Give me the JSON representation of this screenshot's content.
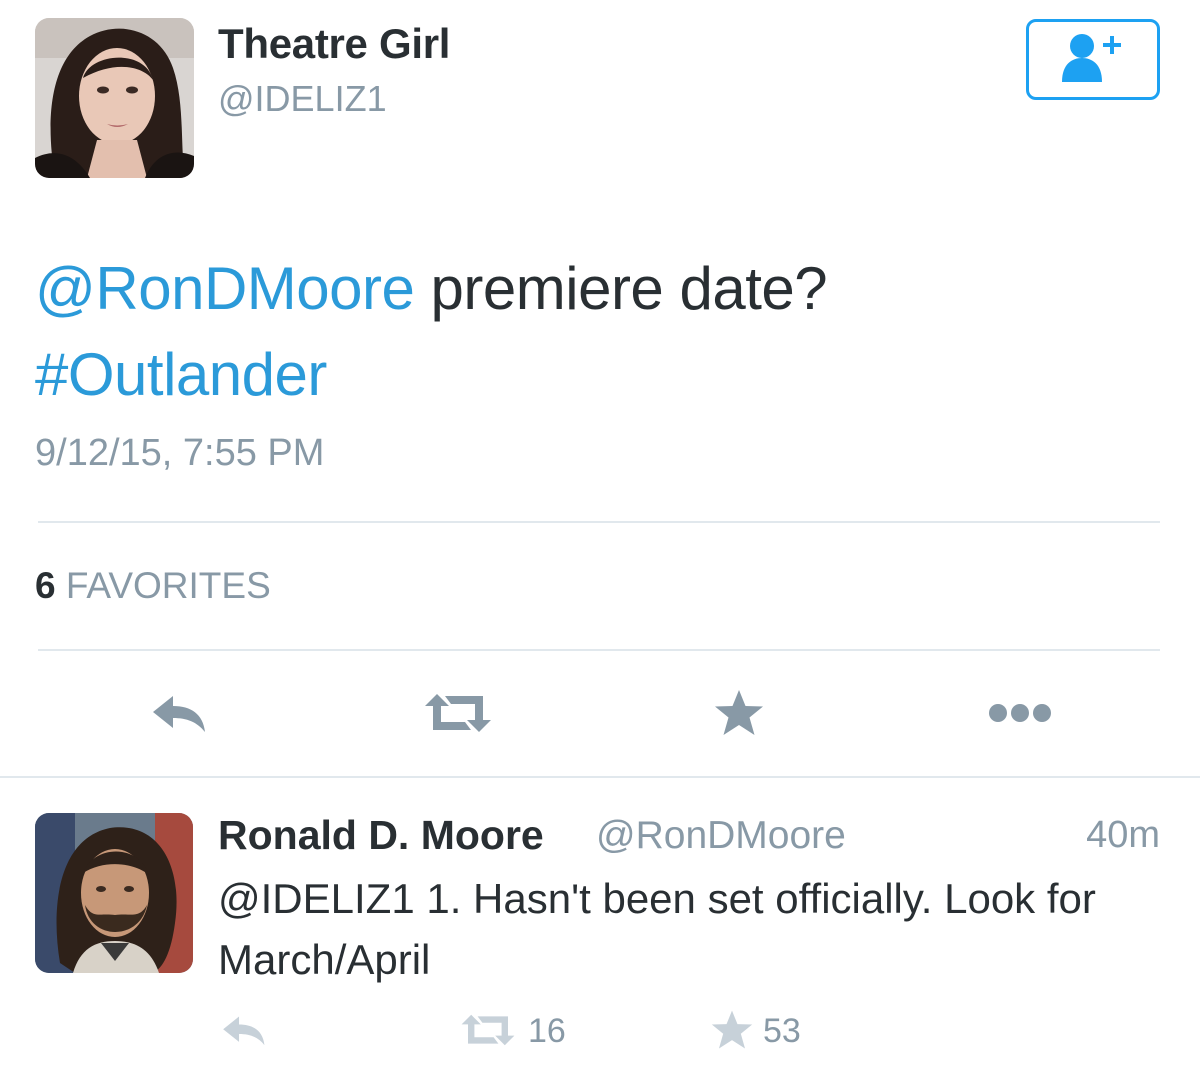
{
  "tweet": {
    "display_name": "Theatre Girl",
    "handle": "@IDELIZ1",
    "follow_icon": "add-user-icon",
    "mention": "@RonDMoore",
    "text": " premiere date?",
    "hashtag": "#Outlander",
    "timestamp": "9/12/15, 7:55 PM",
    "favorites_count": "6",
    "favorites_label": "FAVORITES",
    "actions": [
      "reply-icon",
      "retweet-icon",
      "favorite-icon",
      "more-icon"
    ]
  },
  "reply": {
    "display_name": "Ronald D. Moore",
    "handle": "@RonDMoore",
    "time": "40m",
    "text": "@IDELIZ1 1.  Hasn't been set officially.  Look for March/April",
    "retweet_count": "16",
    "favorite_count": "53"
  },
  "colors": {
    "link": "#2b9ad9",
    "follow_border": "#1da1f2",
    "secondary_text": "#8899a6",
    "icon": "#8899a6"
  }
}
